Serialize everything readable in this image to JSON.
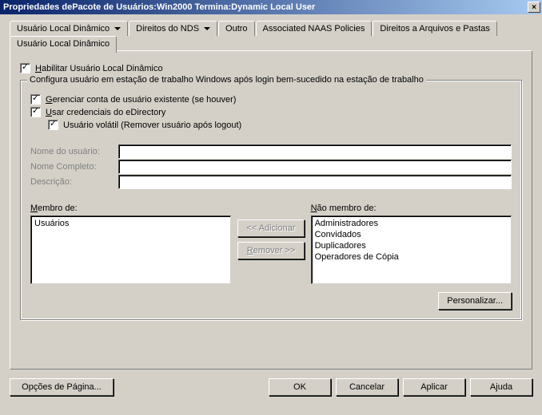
{
  "title": "Propriedades dePacote de Usuários:Win2000 Termina:Dynamic Local User",
  "close_icon": "×",
  "tabs": {
    "row1": [
      {
        "label": "Usuário Local Dinâmico",
        "dropdown": true,
        "active": false
      },
      {
        "label": "Direitos do NDS",
        "dropdown": true,
        "active": false
      },
      {
        "label": "Outro",
        "dropdown": false,
        "active": false
      },
      {
        "label": "Associated NAAS Policies",
        "dropdown": false,
        "active": false
      },
      {
        "label": "Direitos a Arquivos e Pastas",
        "dropdown": false,
        "active": false
      }
    ],
    "row2": [
      {
        "label": "Usuário Local Dinâmico",
        "dropdown": false,
        "active": true
      }
    ]
  },
  "enable_checkbox": {
    "checked": true,
    "prefix": "H",
    "rest": "abilitar Usuário Local Dinâmico"
  },
  "group": {
    "legend": "Configura usuário em estação de trabalho Windows após login bem-sucedido na estação de trabalho",
    "manage": {
      "checked": true,
      "prefix": "G",
      "rest": "erenciar conta de usuário existente (se houver)"
    },
    "usecred": {
      "checked": true,
      "prefix": "U",
      "rest": "sar credenciais do eDirectory"
    },
    "volatile": {
      "checked": true,
      "label": "Usuário volátil (Remover usuário após logout)"
    },
    "fields": {
      "username_label": "Nome do usuário:",
      "fullname_label": "Nome Completo:",
      "description_label": "Descrição:",
      "username": "",
      "fullname": "",
      "description": ""
    },
    "member_of_label": "Membro de:",
    "member_of": [
      "Usuários"
    ],
    "not_member_label": "Não membro de:",
    "not_member": [
      "Administradores",
      "Convidados",
      "Duplicadores",
      "Operadores de Cópia"
    ],
    "btn_add": "<< Adicionar",
    "btn_remove": "Remover >>",
    "btn_personalize": "Personalizar..."
  },
  "footer": {
    "page_options": "Opções de Página...",
    "ok": "OK",
    "cancel": "Cancelar",
    "apply": "Aplicar",
    "help": "Ajuda"
  }
}
